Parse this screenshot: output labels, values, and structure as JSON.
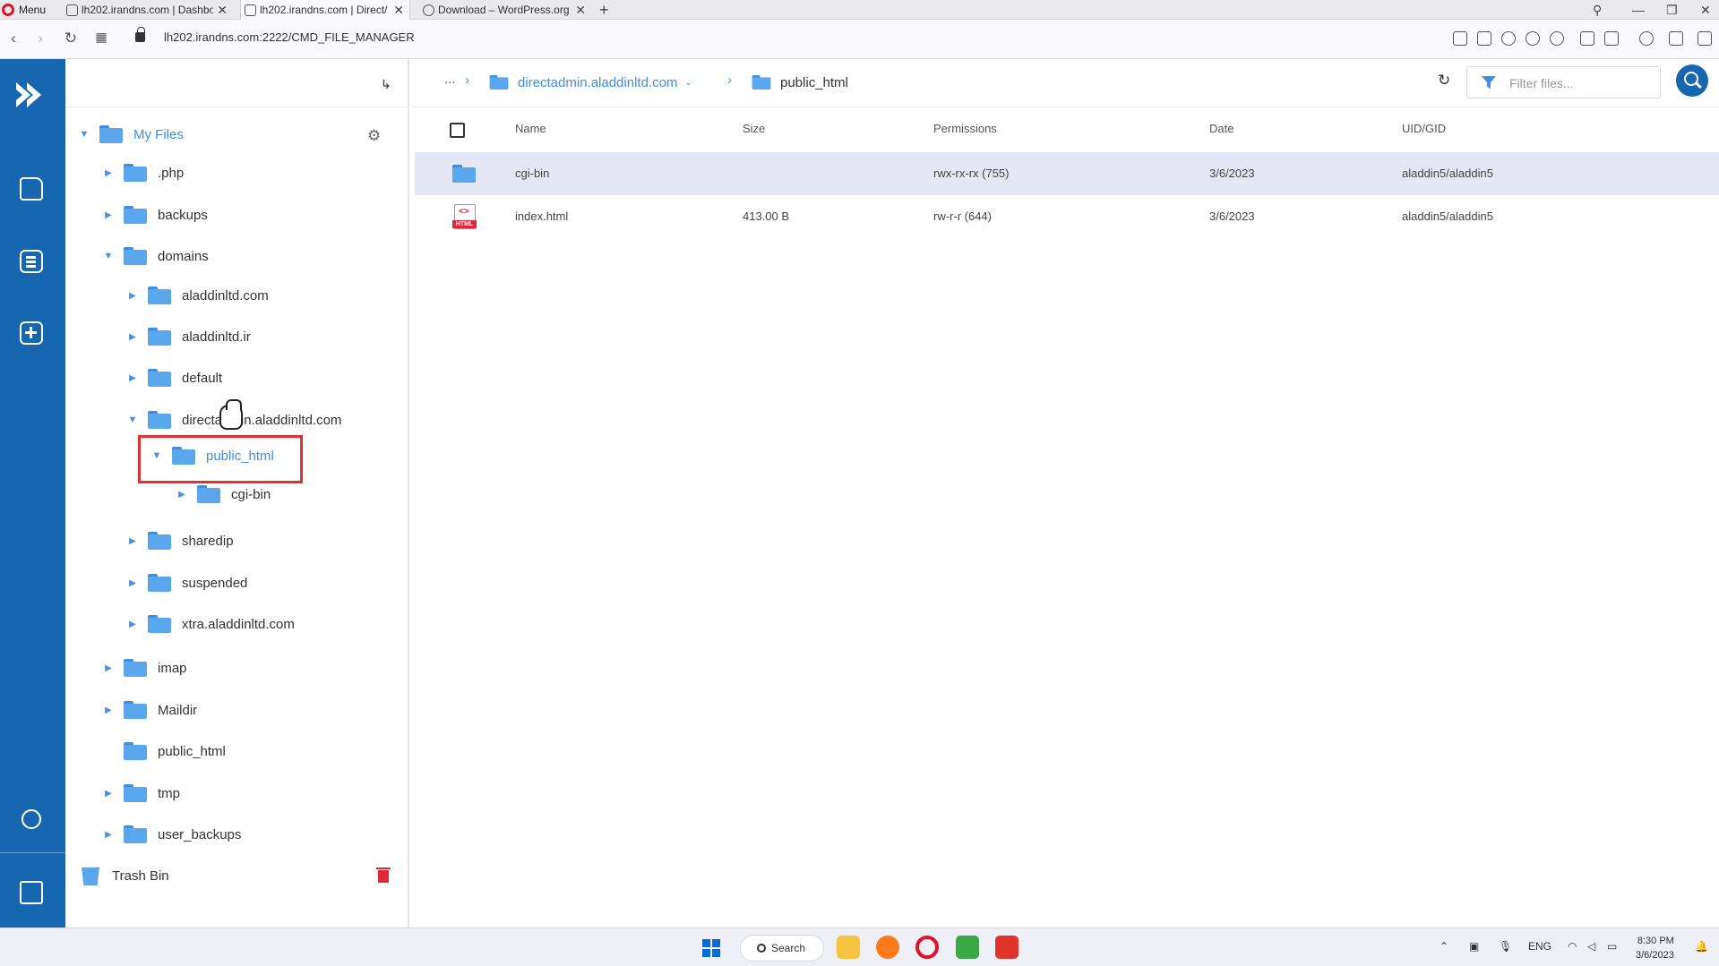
{
  "browser": {
    "menu_label": "Menu",
    "tabs": [
      {
        "title": "lh202.irandns.com | Dashbo"
      },
      {
        "title": "lh202.irandns.com | Direct/"
      },
      {
        "title": "Download – WordPress.org"
      }
    ],
    "url": "lh202.irandns.com:2222/CMD_FILE_MANAGER"
  },
  "tree": {
    "root": "My Files",
    "items": [
      {
        "label": ".php"
      },
      {
        "label": "backups"
      },
      {
        "label": "domains"
      },
      {
        "label": "aladdinltd.com"
      },
      {
        "label": "aladdinltd.ir"
      },
      {
        "label": "default"
      },
      {
        "label": "directadmin.aladdinltd.com"
      },
      {
        "label": "public_html"
      },
      {
        "label": "cgi-bin"
      },
      {
        "label": "sharedip"
      },
      {
        "label": "suspended"
      },
      {
        "label": "xtra.aladdinltd.com"
      },
      {
        "label": "imap"
      },
      {
        "label": "Maildir"
      },
      {
        "label": "public_html"
      },
      {
        "label": "tmp"
      },
      {
        "label": "user_backups"
      }
    ],
    "trash": "Trash Bin"
  },
  "breadcrumb": {
    "ellipsis": "...",
    "parent": "directadmin.aladdinltd.com",
    "current": "public_html"
  },
  "filter": {
    "placeholder": "Filter files..."
  },
  "table": {
    "columns": [
      "Name",
      "Size",
      "Permissions",
      "Date",
      "UID/GID"
    ],
    "rows": [
      {
        "name": "cgi-bin",
        "size": "",
        "permissions": "rwx-rx-rx (755)",
        "date": "3/6/2023",
        "uid": "aladdin5/aladdin5"
      },
      {
        "name": "index.html",
        "size": "413.00 B",
        "permissions": "rw-r-r (644)",
        "date": "3/6/2023",
        "uid": "aladdin5/aladdin5"
      }
    ]
  },
  "taskbar": {
    "search_label": "Search",
    "lang": "ENG",
    "time": "8:30 PM",
    "date": "3/6/2023"
  },
  "colors": {
    "accent": "#1666b0",
    "folder": "#5aa7ee",
    "highlight": "#e03232",
    "selected_row": "#e6e7f4"
  }
}
